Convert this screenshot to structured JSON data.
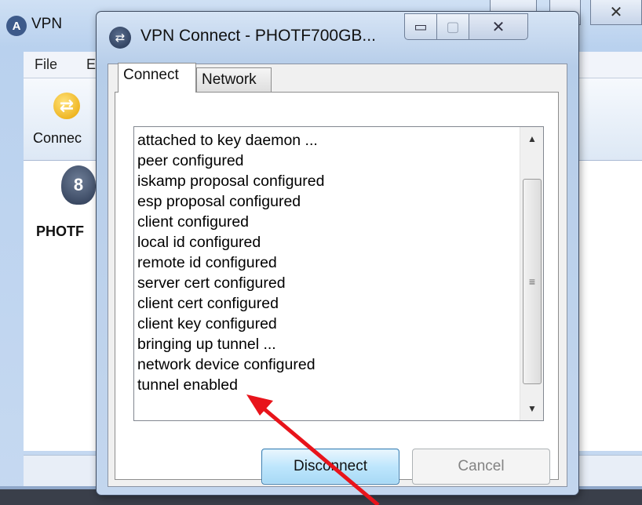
{
  "main_window": {
    "icon_glyph": "A",
    "title": "VPN",
    "menu": [
      "File",
      "E"
    ],
    "toolbar_label": "Connec",
    "site_label": "PHOTF",
    "close_glyph": "✕"
  },
  "dialog": {
    "title": "VPN Connect - PHOTF700GB...",
    "controls": {
      "minimize": "▭",
      "maximize": "▢",
      "close": "✕"
    },
    "tabs": [
      {
        "label": "Connect",
        "active": true
      },
      {
        "label": "Network",
        "active": false
      }
    ],
    "log_lines": [
      "attached to key daemon ...",
      "peer configured",
      "iskamp proposal configured",
      "esp proposal configured",
      "client configured",
      "local id configured",
      "remote id configured",
      "server cert configured",
      "client cert configured",
      "client key configured",
      "bringing up tunnel ...",
      "network device configured",
      "tunnel enabled"
    ],
    "scrollbar": {
      "up": "▲",
      "down": "▼",
      "grip": "≡"
    },
    "buttons": {
      "disconnect": "Disconnect",
      "cancel": "Cancel"
    }
  },
  "colors": {
    "annotation_arrow": "#e8141b",
    "default_button_border": "#3c7fb1"
  },
  "icons": {
    "main_app": "vpn-lock-icon",
    "toolbar_connect": "connect-icon",
    "site": "lock-icon",
    "dialog": "vpn-connect-icon"
  }
}
